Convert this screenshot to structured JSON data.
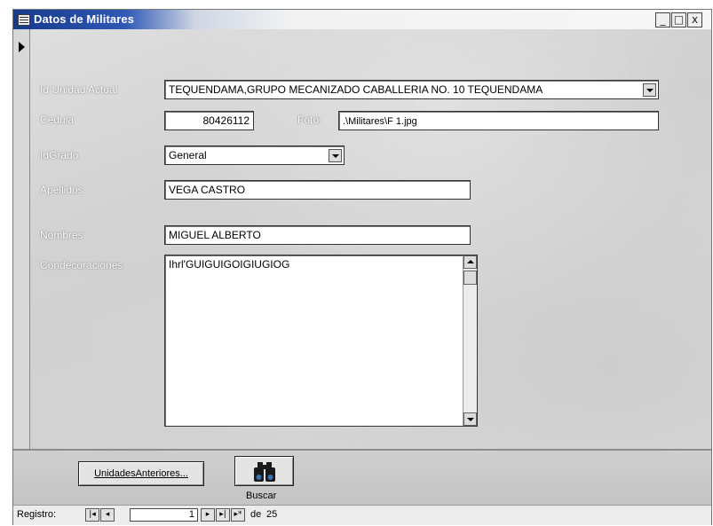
{
  "window": {
    "title": "Datos de Militares",
    "controls": {
      "minimize": "_",
      "maximize": "□",
      "close": "x"
    }
  },
  "form": {
    "id_unidad": {
      "label": "Id Unidad Actual",
      "value": "TEQUENDAMA,GRUPO MECANIZADO CABALLERIA NO. 10 TEQUENDAMA"
    },
    "cedula": {
      "label": "Cedula",
      "value": "80426112"
    },
    "foto": {
      "label": "Foto:",
      "value": ".\\Militares\\F 1.jpg"
    },
    "idgrado": {
      "label": "IdGrado",
      "value": "General"
    },
    "apellidos": {
      "label": "Apellidos",
      "value": "VEGA CASTRO"
    },
    "nombres": {
      "label": "Nombres",
      "value": "MIGUEL ALBERTO"
    },
    "condecoraciones": {
      "label": "Condecoraciones",
      "value": "Ihrl'GUIGUIGOIGIUGIOG"
    }
  },
  "footer": {
    "unidades_button": "UnidadesAnteriores...",
    "buscar_label": "Buscar",
    "binoculars_icon": "binoculars-icon"
  },
  "navigation": {
    "label": "Registro:",
    "current": "1",
    "of_label": "de",
    "total": "25",
    "buttons": {
      "first": "|◂",
      "prev": "◂",
      "next": "▸",
      "last": "▸|",
      "new": "▸*"
    }
  }
}
